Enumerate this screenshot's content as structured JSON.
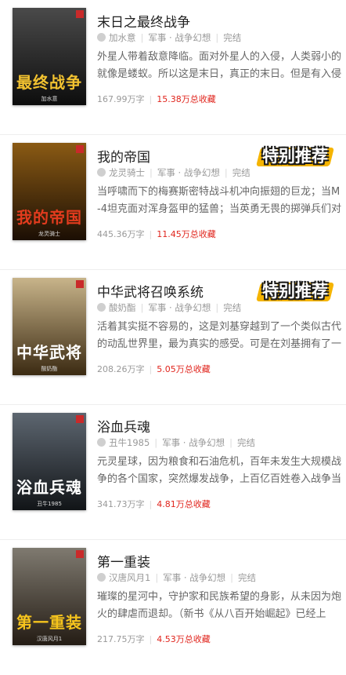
{
  "books": [
    {
      "title": "末日之最终战争",
      "author": "加水意",
      "category": "军事",
      "subcategory": "战争幻想",
      "status": "完结",
      "description": "外星人带着敌意降临。面对外星人的入侵，人类弱小的就像是蝼蚁。所以这是末日，真正的末日。但是有入侵",
      "word_count": "167.99万字",
      "favorites": "15.38万总收藏",
      "cover_title": "最终战争",
      "cover_author": "加水意",
      "cover_colors": [
        "#4a4a4a",
        "#0d0d0d"
      ],
      "cover_text_color": "#f2c230",
      "badge": ""
    },
    {
      "title": "我的帝国",
      "author": "龙灵骑士",
      "category": "军事",
      "subcategory": "战争幻想",
      "status": "完结",
      "description": "当呼啸而下的梅赛斯密特战斗机冲向振翅的巨龙；当M-4坦克面对浑身盔甲的猛兽；当英勇无畏的掷弹兵们对魔",
      "word_count": "445.36万字",
      "favorites": "11.45万总收藏",
      "cover_title": "我的帝国",
      "cover_author": "龙灵骑士",
      "cover_colors": [
        "#8a5a14",
        "#1b0e04"
      ],
      "cover_text_color": "#e23b1e",
      "badge": "特别推荐"
    },
    {
      "title": "中华武将召唤系统",
      "author": "酸奶酯",
      "category": "军事",
      "subcategory": "战争幻想",
      "status": "完结",
      "description": "活着其实挺不容易的，这是刘基穿越到了一个类似古代的动乱世界里，最为真实的感受。可是在刘基拥有了一",
      "word_count": "208.26万字",
      "favorites": "5.05万总收藏",
      "cover_title": "中华武将",
      "cover_author": "酸奶酯",
      "cover_colors": [
        "#c8b48a",
        "#3b2a12"
      ],
      "cover_text_color": "#ffffff",
      "badge": "特别推荐"
    },
    {
      "title": "浴血兵魂",
      "author": "丑牛1985",
      "category": "军事",
      "subcategory": "战争幻想",
      "status": "完结",
      "description": "元灵星球，因为粮食和石油危机，百年未发生大规模战争的各个国家，突然爆发战争，上百亿百姓卷入战争当",
      "word_count": "341.73万字",
      "favorites": "4.81万总收藏",
      "cover_title": "浴血兵魂",
      "cover_author": "丑牛1985",
      "cover_colors": [
        "#5d6670",
        "#111417"
      ],
      "cover_text_color": "#ffffff",
      "badge": ""
    },
    {
      "title": "第一重装",
      "author": "汉唐风月1",
      "category": "军事",
      "subcategory": "战争幻想",
      "status": "完结",
      "description": "璀璨的星河中，守护家和民族希望的身影，从未因为炮火的肆虐而退却。（新书《从八百开始崛起》已经上",
      "word_count": "217.75万字",
      "favorites": "4.53万总收藏",
      "cover_title": "第一重装",
      "cover_author": "汉唐风月1",
      "cover_colors": [
        "#7f7a70",
        "#241c14"
      ],
      "cover_text_color": "#f6c41d",
      "badge": ""
    }
  ]
}
